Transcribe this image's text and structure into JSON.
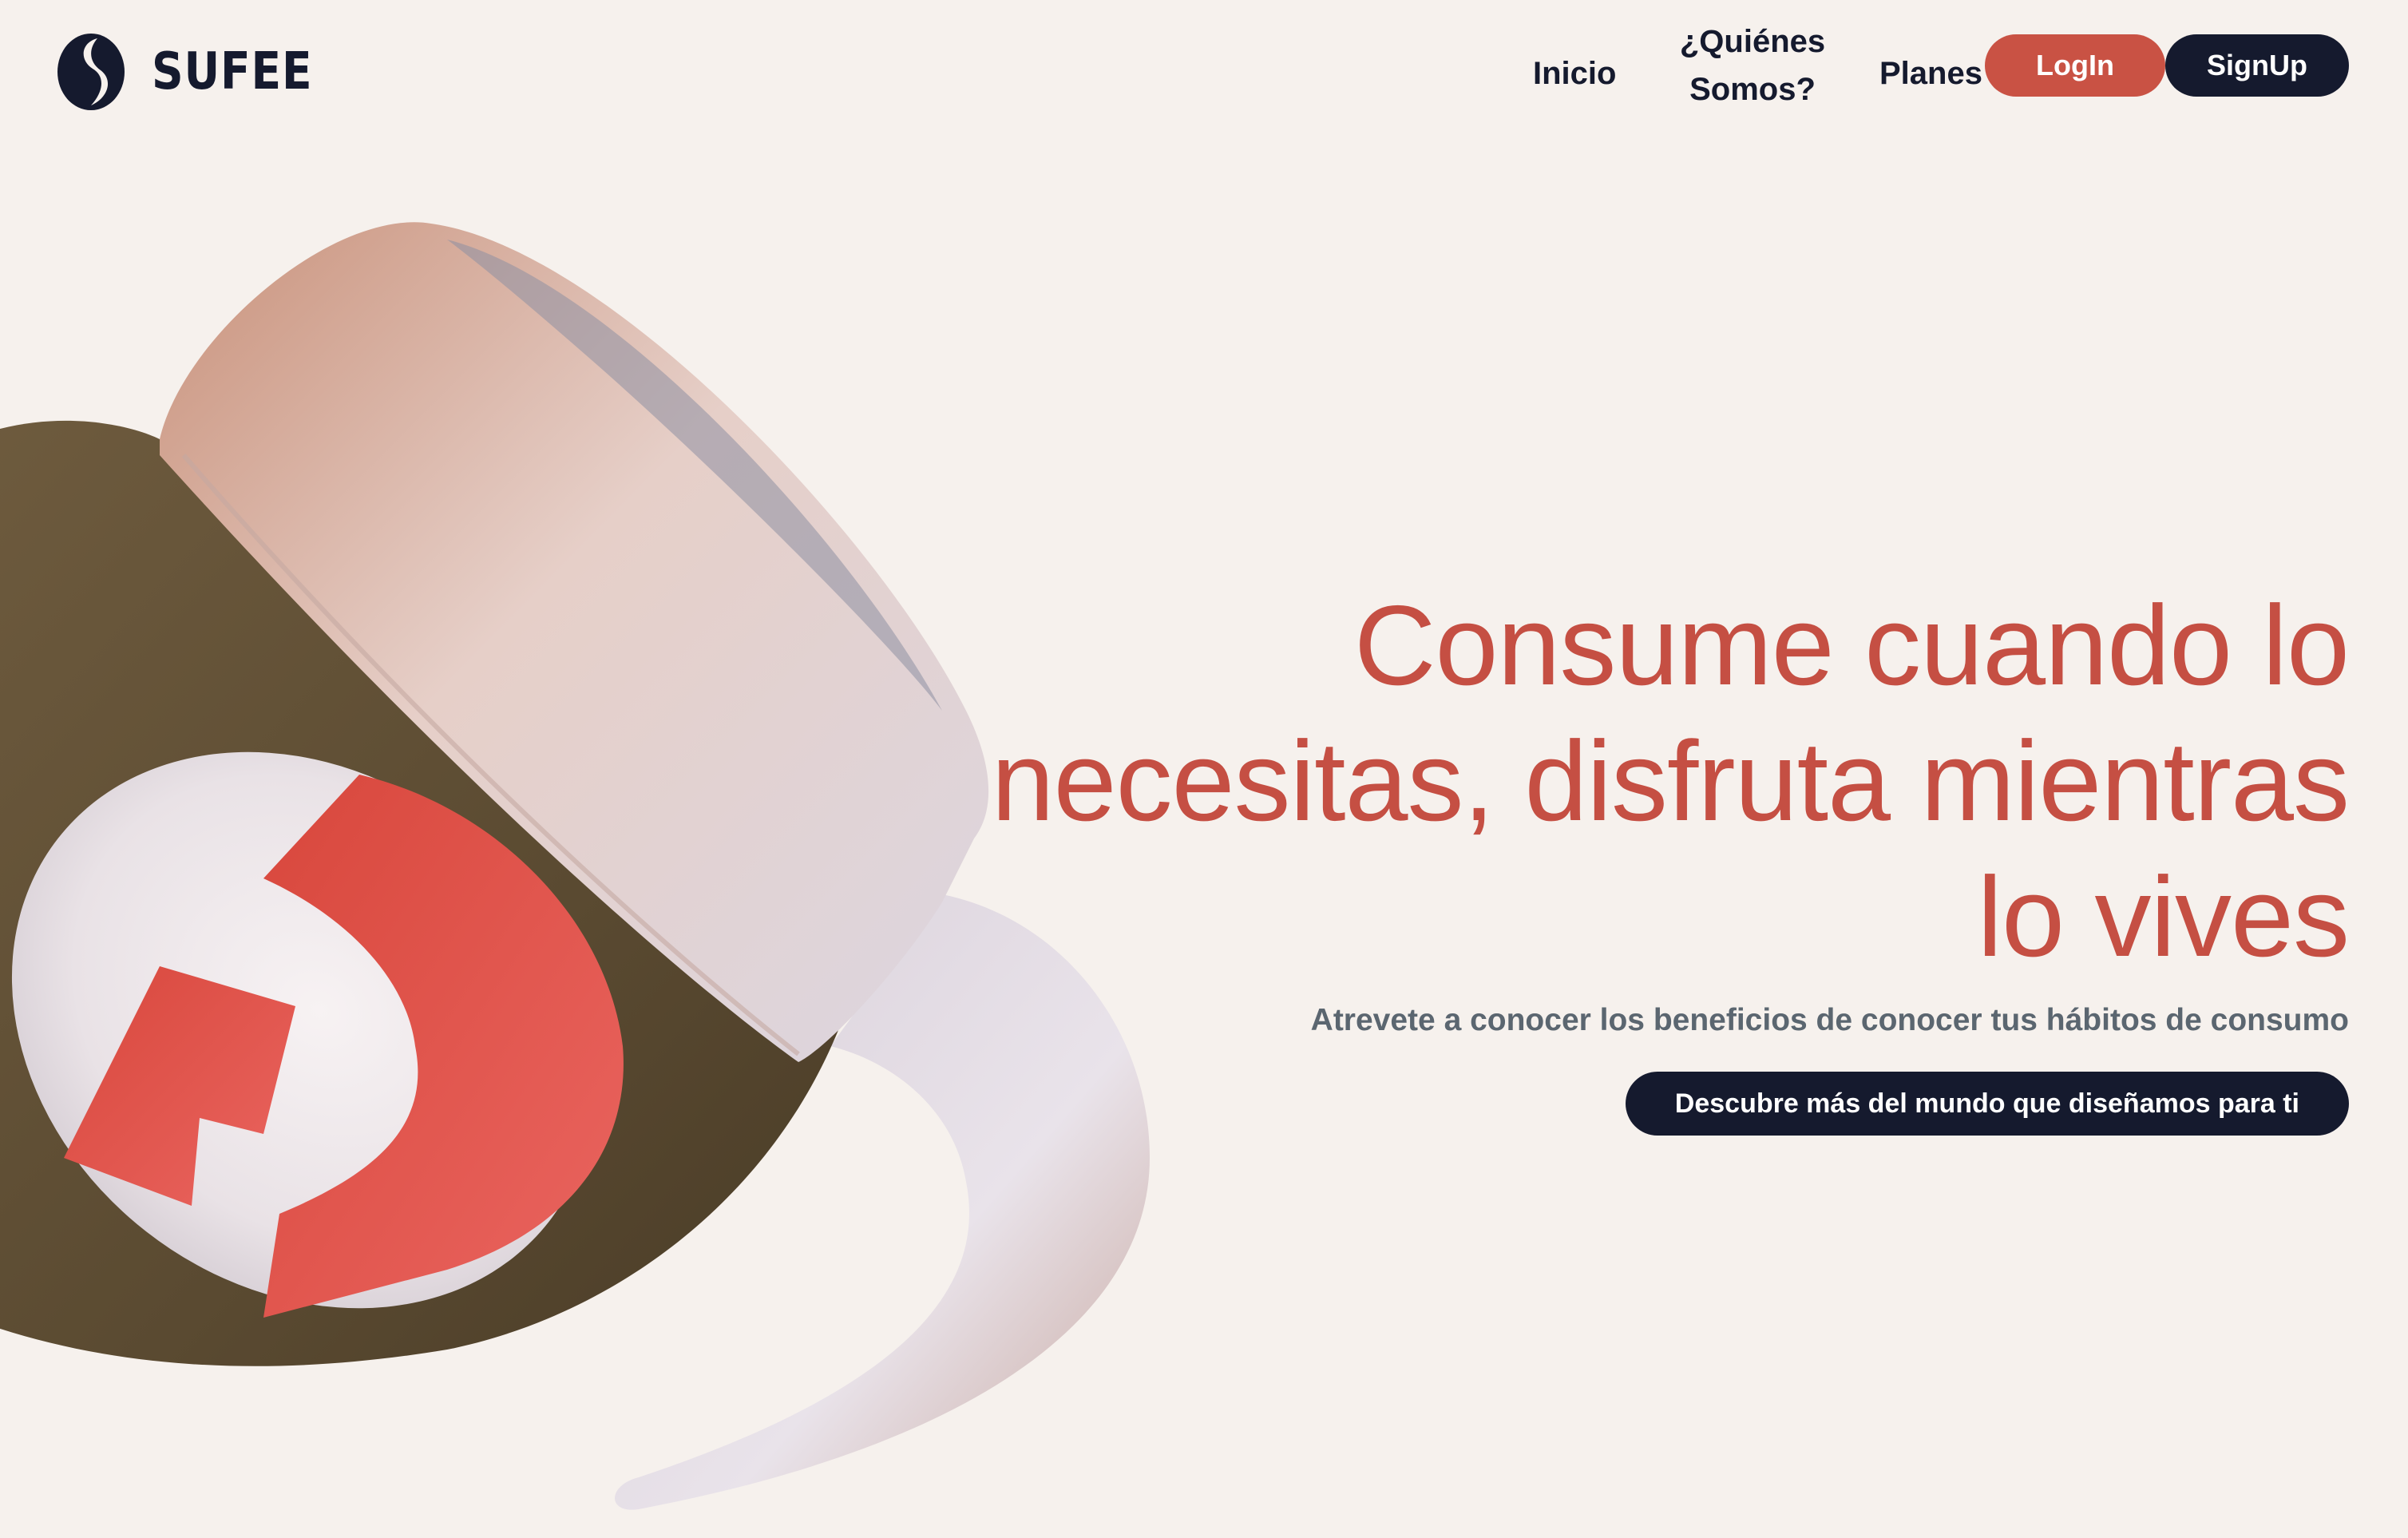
{
  "brand": {
    "name": "SUFEE",
    "logo_icon": "s-swirl-logo-icon",
    "color": "#151a2e"
  },
  "nav": {
    "inicio": "Inicio",
    "quienes_line1": "¿Quiénes",
    "quienes_line2": "Somos?",
    "planes": "Planes"
  },
  "auth": {
    "login_label": "LogIn",
    "signup_label": "SignUp",
    "login_color": "#c95244",
    "signup_color": "#151a2e"
  },
  "hero": {
    "title_line1": "Consume cuando lo",
    "title_line2": "necesitas, disfruta mientras",
    "title_line3": "lo vives",
    "subtitle": "Atrevete a conocer los beneficios de conocer tus hábitos de consumo",
    "cta_label": "Descubre más del mundo que diseñamos para ti",
    "accent_color": "#c54f43"
  },
  "background_color": "#f6f1ed"
}
